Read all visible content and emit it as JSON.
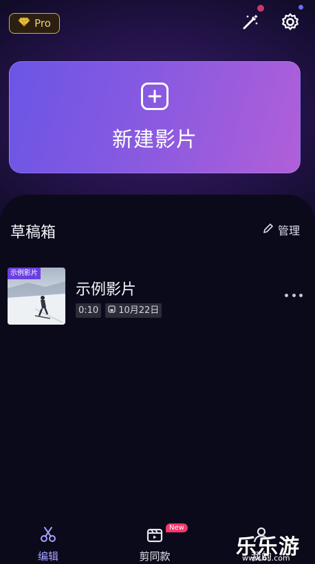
{
  "header": {
    "pro_label": "Pro",
    "icons": [
      "diamond-icon",
      "magic-wand-icon",
      "gear-icon"
    ]
  },
  "new_project": {
    "label": "新建影片",
    "icon": "plus-square-icon"
  },
  "drafts": {
    "title": "草稿箱",
    "manage_label": "管理",
    "items": [
      {
        "tag": "示例影片",
        "name": "示例影片",
        "duration": "0:10",
        "date": "10月22日"
      }
    ]
  },
  "bottom_nav": {
    "items": [
      {
        "label": "编辑",
        "icon": "scissors-icon"
      },
      {
        "label": "剪同款",
        "icon": "template-icon",
        "badge": "New"
      },
      {
        "label": "我的",
        "icon": "user-icon"
      }
    ]
  },
  "watermark": {
    "text": "乐乐游戏",
    "url": "www.6ll.com"
  },
  "colors": {
    "accent": "#a6a2ff",
    "card_start": "#6b55e6",
    "card_end": "#b15fd8",
    "badge": "#f03a6a"
  }
}
